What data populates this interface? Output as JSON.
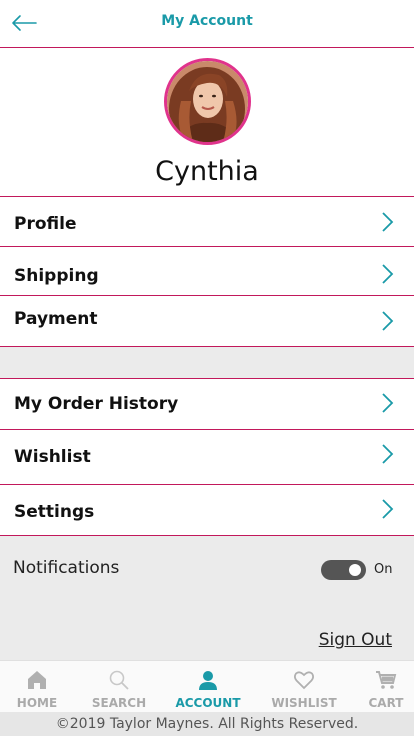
{
  "header": {
    "title": "My Account"
  },
  "profile": {
    "name": "Cynthia"
  },
  "menu_group_1": [
    {
      "label": "Profile"
    },
    {
      "label": "Shipping"
    },
    {
      "label": "Payment"
    }
  ],
  "menu_group_2": [
    {
      "label": "My Order History"
    },
    {
      "label": "Wishlist"
    },
    {
      "label": "Settings"
    }
  ],
  "notifications": {
    "label": "Notifications",
    "state": "On"
  },
  "sign_out": "Sign Out",
  "tabs": [
    {
      "label": "HOME",
      "icon": "home-icon"
    },
    {
      "label": "SEARCH",
      "icon": "search-icon"
    },
    {
      "label": "ACCOUNT",
      "icon": "user-icon",
      "active": true
    },
    {
      "label": "WISHLIST",
      "icon": "heart-icon"
    },
    {
      "label": "CART",
      "icon": "cart-icon"
    }
  ],
  "footer": "©2019 Taylor Maynes. All Rights Reserved.",
  "colors": {
    "accent": "#1a9aa8",
    "divider": "#c2185b",
    "avatar_ring": "#e0338c"
  }
}
